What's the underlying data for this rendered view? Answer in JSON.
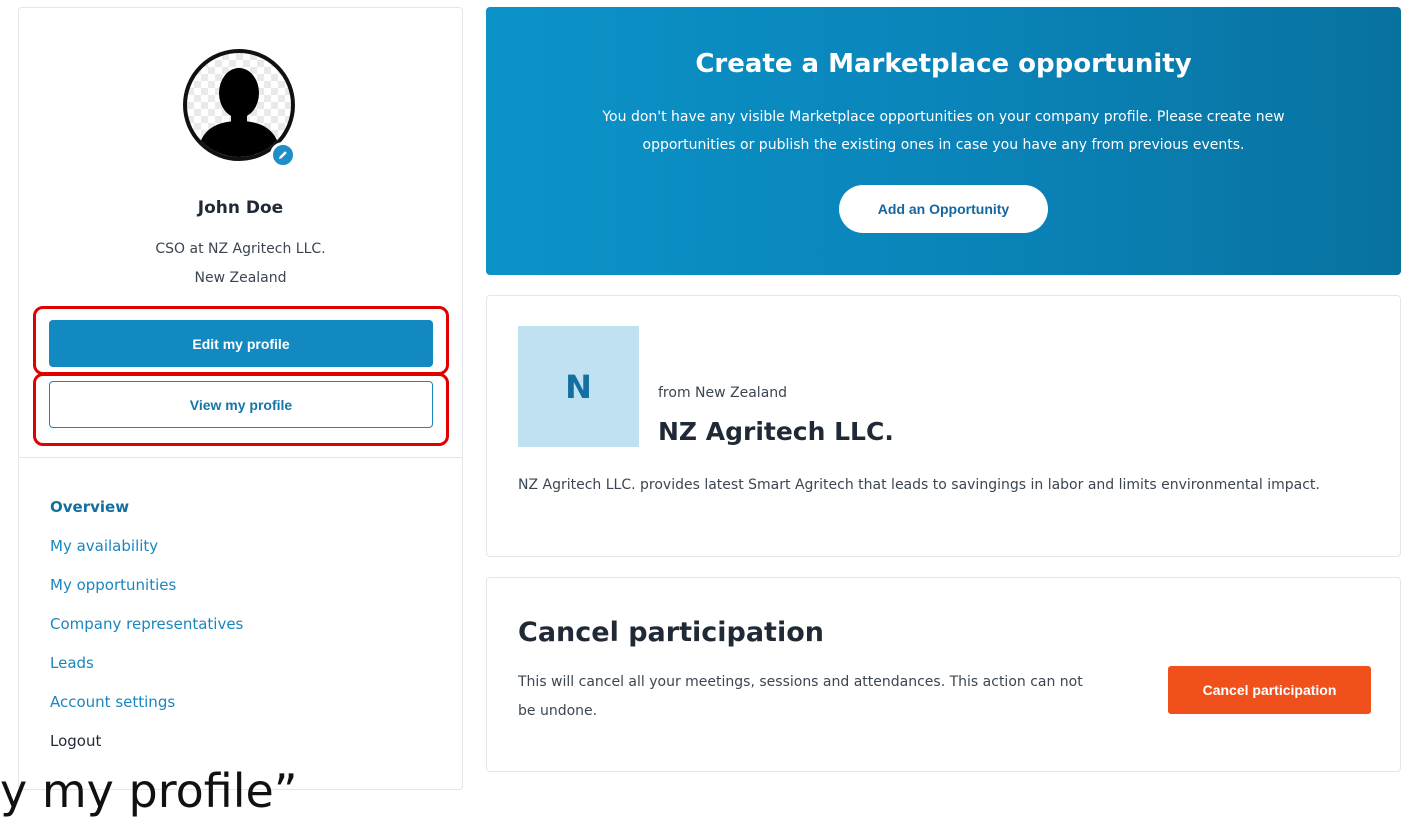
{
  "profile": {
    "name": "John Doe",
    "title": "CSO at NZ Agritech LLC.",
    "country": "New Zealand",
    "edit_button": "Edit my profile",
    "view_button": "View my profile"
  },
  "nav": {
    "items": [
      {
        "label": "Overview",
        "active": true
      },
      {
        "label": "My availability"
      },
      {
        "label": "My opportunities"
      },
      {
        "label": "Company representatives"
      },
      {
        "label": "Leads"
      },
      {
        "label": "Account settings"
      },
      {
        "label": "Logout"
      }
    ]
  },
  "overlay": {
    "caption": "y my profile”"
  },
  "banner": {
    "title": "Create a Marketplace opportunity",
    "text": "You don't have any visible Marketplace opportunities on your company profile. Please create new opportunities or publish the existing ones in case you have any from previous events.",
    "button": "Add an Opportunity"
  },
  "company": {
    "initial": "N",
    "from": "from New Zealand",
    "name": "NZ Agritech LLC.",
    "description": "NZ Agritech LLC. provides latest Smart Agritech that leads to savingings in labor and limits environmental impact."
  },
  "cancel": {
    "title": "Cancel participation",
    "text": "This will cancel all your meetings, sessions and attendances. This action can not be undone.",
    "button": "Cancel participation"
  },
  "colors": {
    "primary": "#1389c1",
    "link": "#1a86bf",
    "danger": "#f0501c",
    "highlight": "#e00000",
    "logo_bg": "#bfe1f1"
  },
  "icons": {
    "avatar": "person-silhouette-icon",
    "edit_badge": "pencil-icon"
  }
}
